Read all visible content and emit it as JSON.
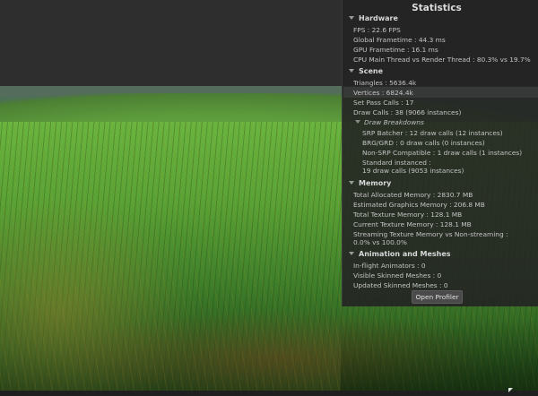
{
  "window": {
    "title": "Statistics"
  },
  "panel": {
    "hardware": {
      "heading": "Hardware",
      "fps": "FPS : 22.6 FPS",
      "global_frametime": "Global Frametime : 44.3 ms",
      "gpu_frametime": "GPU Frametime : 16.1 ms",
      "cpu_main_vs_render": "CPU Main Thread vs Render Thread : 80.3% vs 19.7%"
    },
    "scene": {
      "heading": "Scene",
      "triangles": "Triangles : 5636.4k",
      "vertices": "Vertices : 6824.4k",
      "set_pass_calls": "Set Pass Calls : 17",
      "draw_calls": "Draw Calls : 38 (9066 instances)",
      "draw_breakdowns": {
        "heading": "Draw Breakdowns",
        "srp_batcher": "SRP Batcher : 12 draw calls (12 instances)",
        "brg_grd": "BRG/GRD : 0 draw calls (0 instances)",
        "non_srp_compatible": "Non-SRP Compatible : 1 draw calls (1 instances)",
        "standard_instanced_label": "Standard instanced :",
        "standard_instanced_value": "19 draw calls (9053 instances)"
      }
    },
    "memory": {
      "heading": "Memory",
      "total_allocated": "Total Allocated Memory : 2830.7 MB",
      "estimated_graphics": "Estimated Graphics Memory : 206.8 MB",
      "total_texture": "Total Texture Memory : 128.1 MB",
      "current_texture": "Current Texture Memory : 128.1 MB",
      "streaming_label": "Streaming Texture Memory vs Non-streaming :",
      "streaming_value": "0.0% vs 100.0%"
    },
    "animation": {
      "heading": "Animation and Meshes",
      "in_flight_animators": "In-flight Animators : 0",
      "visible_skinned_meshes": "Visible Skinned Meshes : 0",
      "updated_skinned_meshes": "Updated Skinned Meshes : 0"
    },
    "open_profiler_label": "Open Profiler"
  },
  "colors": {
    "panel_background": "#242424",
    "panel_text": "#c4c4c4",
    "grass": "#5aa235"
  },
  "icons": {
    "section_foldout": "triangle-down-icon",
    "cursor": "mouse-pointer-icon"
  }
}
